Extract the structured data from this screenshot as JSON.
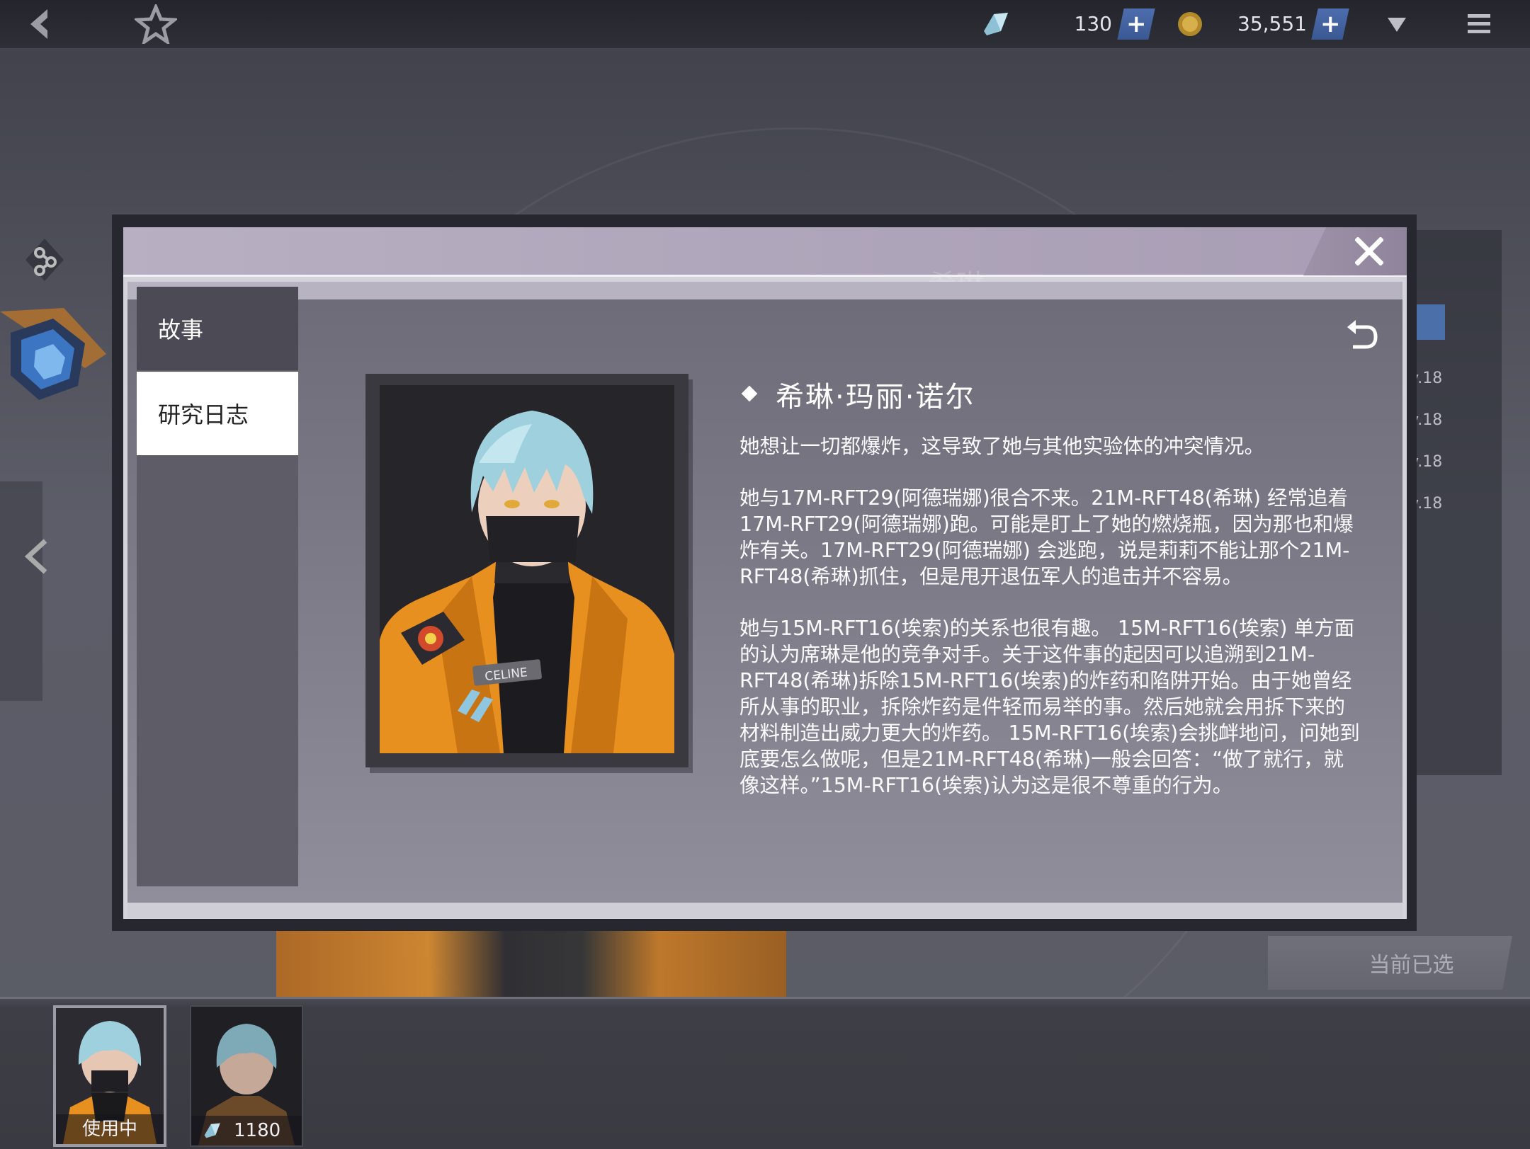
{
  "topbar": {
    "crystal_count": "130",
    "coin_count": "35,551",
    "icons": {
      "back": "back-arrow-icon",
      "favorite": "star-icon",
      "crystal": "crystal-icon",
      "coin": "coin-icon",
      "dropdown": "triangle-down-icon",
      "menu": "hamburger-menu-icon"
    }
  },
  "background": {
    "header_ghost_name": "希琳",
    "side_levels": [
      "v.18",
      "v.18",
      "v.18",
      "v.18"
    ],
    "current_selected_label": "当前已选"
  },
  "modal": {
    "tabs": [
      {
        "label": "故事",
        "active": false
      },
      {
        "label": "研究日志",
        "active": true
      }
    ],
    "character_name": "希琳·玛丽·诺尔",
    "paragraphs": [
      "她想让一切都爆炸，这导致了她与其他实验体的冲突情况。",
      "她与17M-RFT29(阿德瑞娜)很合不来。21M-RFT48(希琳) 经常追着 17M-RFT29(阿德瑞娜)跑。可能是盯上了她的燃烧瓶，因为那也和爆炸有关。17M-RFT29(阿德瑞娜) 会逃跑，说是莉莉不能让那个21M-RFT48(希琳)抓住，但是甩开退伍军人的追击并不容易。",
      "她与15M-RFT16(埃索)的关系也很有趣。 15M-RFT16(埃索) 单方面的认为席琳是他的竞争对手。关于这件事的起因可以追溯到21M-RFT48(希琳)拆除15M-RFT16(埃索)的炸药和陷阱开始。由于她曾经所从事的职业，拆除炸药是件轻而易举的事。然后她就会用拆下来的材料制造出威力更大的炸药。 15M-RFT16(埃索)会挑衅地问，问她到底要怎么做呢，但是21M-RFT48(希琳)一般会回答：“做了就行，就像这样。”15M-RFT16(埃索)认为这是很不尊重的行为。"
    ],
    "portrait_badge": "CELINE",
    "close_label": "X"
  },
  "skins": [
    {
      "caption": "使用中"
    },
    {
      "caption": "1180"
    }
  ],
  "colors": {
    "jacket_orange": "#e8901f",
    "hair_blue": "#9fd0de",
    "active_tab_bg": "#ffffff",
    "plus_button_blue": "#4d6dad"
  }
}
